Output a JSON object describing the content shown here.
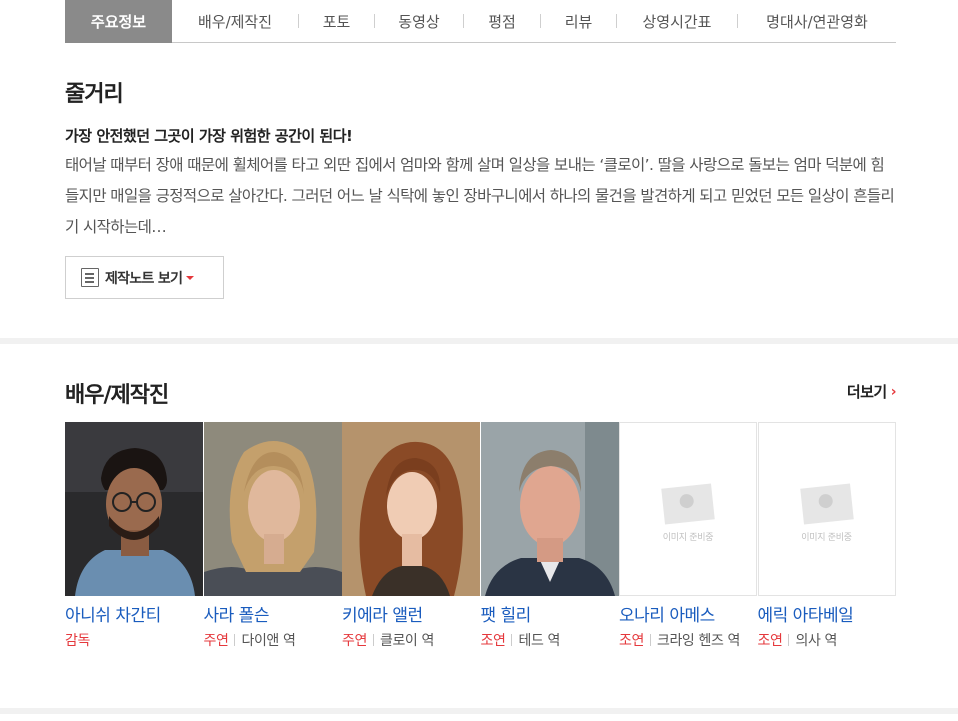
{
  "tabs": [
    {
      "label": "주요정보",
      "active": true
    },
    {
      "label": "배우/제작진",
      "active": false
    },
    {
      "label": "포토",
      "active": false
    },
    {
      "label": "동영상",
      "active": false
    },
    {
      "label": "평점",
      "active": false
    },
    {
      "label": "리뷰",
      "active": false
    },
    {
      "label": "상영시간표",
      "active": false
    },
    {
      "label": "명대사/연관영화",
      "active": false
    }
  ],
  "plot": {
    "title": "줄거리",
    "tagline": "가장 안전했던 그곳이 가장 위험한 공간이 된다!",
    "synopsis": "태어날 때부터 장애 때문에 휠체어를 타고 외딴 집에서 엄마와 함께 살며 일상을 보내는 ‘클로이’. 딸을 사랑으로 돌보는 엄마 덕분에 힘들지만 매일을 긍정적으로 살아간다. 그러던 어느 날 식탁에 놓인 장바구니에서 하나의 물건을 발견하게 되고 믿었던 모든 일상이 흔들리기 시작하는데…",
    "note_button": "제작노트 보기"
  },
  "cast": {
    "title": "배우/제작진",
    "more": "더보기",
    "no_image_text": "이미지 준비중",
    "members": [
      {
        "name": "아니쉬 차간티",
        "role_type": "감독",
        "role": ""
      },
      {
        "name": "사라 폴슨",
        "role_type": "주연",
        "role": "다이앤 역"
      },
      {
        "name": "키에라 앨런",
        "role_type": "주연",
        "role": "클로이 역"
      },
      {
        "name": "팻 힐리",
        "role_type": "조연",
        "role": "테드 역"
      },
      {
        "name": "오나리 아메스",
        "role_type": "조연",
        "role": "크라잉 헨즈 역"
      },
      {
        "name": "에릭 아타베일",
        "role_type": "조연",
        "role": "의사 역"
      }
    ]
  },
  "colors": {
    "accent": "#e5383c",
    "link": "#1a5cbe",
    "active_tab": "#8a8a8a"
  }
}
